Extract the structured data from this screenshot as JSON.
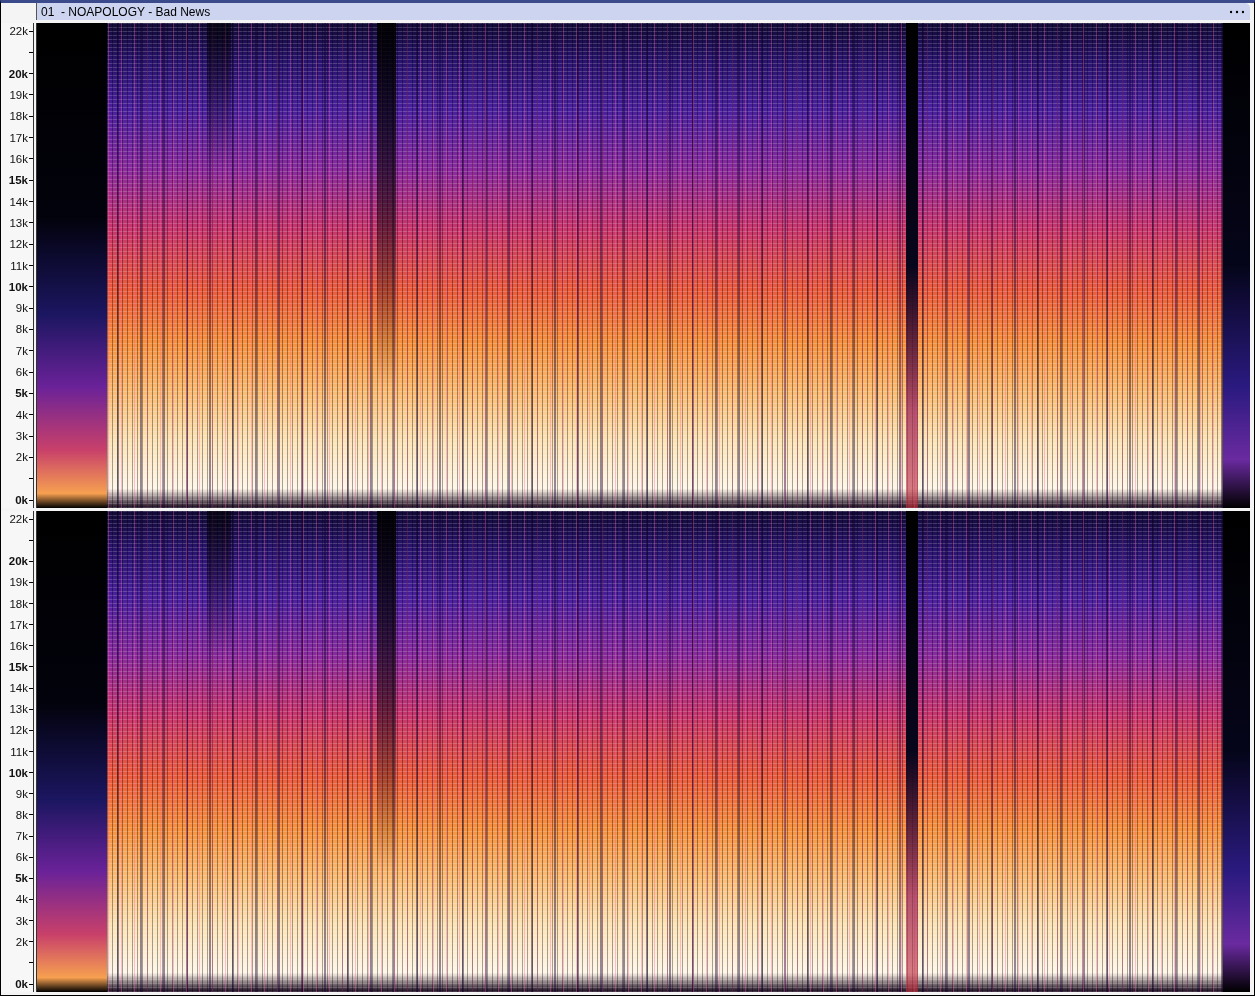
{
  "track": {
    "title": "01  - NOAPOLOGY - Bad News"
  },
  "channels": [
    {
      "ticks": [
        {
          "kind": "labeled",
          "label": "22k",
          "bold": false
        },
        {
          "kind": "tick"
        },
        {
          "kind": "labeled",
          "label": "20k",
          "bold": true
        },
        {
          "kind": "labeled",
          "label": "19k",
          "bold": false
        },
        {
          "kind": "labeled",
          "label": "18k",
          "bold": false
        },
        {
          "kind": "labeled",
          "label": "17k",
          "bold": false
        },
        {
          "kind": "labeled",
          "label": "16k",
          "bold": false
        },
        {
          "kind": "labeled",
          "label": "15k",
          "bold": true
        },
        {
          "kind": "labeled",
          "label": "14k",
          "bold": false
        },
        {
          "kind": "labeled",
          "label": "13k",
          "bold": false
        },
        {
          "kind": "labeled",
          "label": "12k",
          "bold": false
        },
        {
          "kind": "labeled",
          "label": "11k",
          "bold": false
        },
        {
          "kind": "labeled",
          "label": "10k",
          "bold": true
        },
        {
          "kind": "labeled",
          "label": "9k",
          "bold": false
        },
        {
          "kind": "labeled",
          "label": "8k",
          "bold": false
        },
        {
          "kind": "labeled",
          "label": "7k",
          "bold": false
        },
        {
          "kind": "labeled",
          "label": "6k",
          "bold": false
        },
        {
          "kind": "labeled",
          "label": "5k",
          "bold": true
        },
        {
          "kind": "labeled",
          "label": "4k",
          "bold": false
        },
        {
          "kind": "labeled",
          "label": "3k",
          "bold": false
        },
        {
          "kind": "labeled",
          "label": "2k",
          "bold": false
        },
        {
          "kind": "tick"
        },
        {
          "kind": "labeled",
          "label": "0k",
          "bold": true
        }
      ]
    },
    {
      "ticks": [
        {
          "kind": "labeled",
          "label": "22k",
          "bold": false
        },
        {
          "kind": "tick"
        },
        {
          "kind": "labeled",
          "label": "20k",
          "bold": true
        },
        {
          "kind": "labeled",
          "label": "19k",
          "bold": false
        },
        {
          "kind": "labeled",
          "label": "18k",
          "bold": false
        },
        {
          "kind": "labeled",
          "label": "17k",
          "bold": false
        },
        {
          "kind": "labeled",
          "label": "16k",
          "bold": false
        },
        {
          "kind": "labeled",
          "label": "15k",
          "bold": true
        },
        {
          "kind": "labeled",
          "label": "14k",
          "bold": false
        },
        {
          "kind": "labeled",
          "label": "13k",
          "bold": false
        },
        {
          "kind": "labeled",
          "label": "12k",
          "bold": false
        },
        {
          "kind": "labeled",
          "label": "11k",
          "bold": false
        },
        {
          "kind": "labeled",
          "label": "10k",
          "bold": true
        },
        {
          "kind": "labeled",
          "label": "9k",
          "bold": false
        },
        {
          "kind": "labeled",
          "label": "8k",
          "bold": false
        },
        {
          "kind": "labeled",
          "label": "7k",
          "bold": false
        },
        {
          "kind": "labeled",
          "label": "6k",
          "bold": false
        },
        {
          "kind": "labeled",
          "label": "5k",
          "bold": true
        },
        {
          "kind": "labeled",
          "label": "4k",
          "bold": false
        },
        {
          "kind": "labeled",
          "label": "3k",
          "bold": false
        },
        {
          "kind": "labeled",
          "label": "2k",
          "bold": false
        },
        {
          "kind": "tick"
        },
        {
          "kind": "labeled",
          "label": "0k",
          "bold": true
        }
      ]
    }
  ]
}
